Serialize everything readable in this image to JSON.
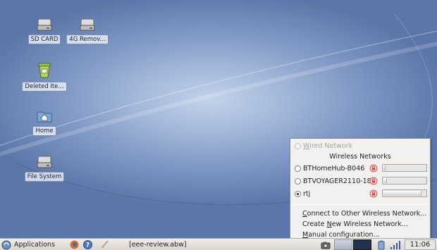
{
  "desktop": {
    "icons": [
      {
        "label": "SD CARD",
        "icon": "drive-icon"
      },
      {
        "label": "4G Remov...",
        "icon": "drive-icon"
      },
      {
        "label": "Deleted Ite...",
        "icon": "trash-icon"
      },
      {
        "label": "Home",
        "icon": "home-folder-icon"
      },
      {
        "label": "File System",
        "icon": "drive-icon"
      }
    ]
  },
  "network_menu": {
    "wired_label": "Wired Network",
    "wireless_header": "Wireless Networks",
    "networks": [
      {
        "ssid": "BTHomeHub-B046",
        "selected": false,
        "signal": 0.05
      },
      {
        "ssid": "BTVOYAGER2110-18",
        "selected": false,
        "signal": 0.08
      },
      {
        "ssid": "rtj",
        "selected": true,
        "signal": 0.9
      }
    ],
    "actions": [
      {
        "pre": "",
        "u": "C",
        "post": "onnect to Other Wireless Network..."
      },
      {
        "pre": "Create ",
        "u": "N",
        "post": "ew Wireless Network..."
      },
      {
        "pre": "",
        "u": "M",
        "post": "anual configuration..."
      }
    ]
  },
  "taskbar": {
    "applications_label": "Applications",
    "window_title": "[eee-review.abw]",
    "clock": "11:06"
  },
  "colors": {
    "desktop_center": "#c3d2ea",
    "desktop_edge": "#5b76a8",
    "menu_bg": "#f2f1ef"
  }
}
